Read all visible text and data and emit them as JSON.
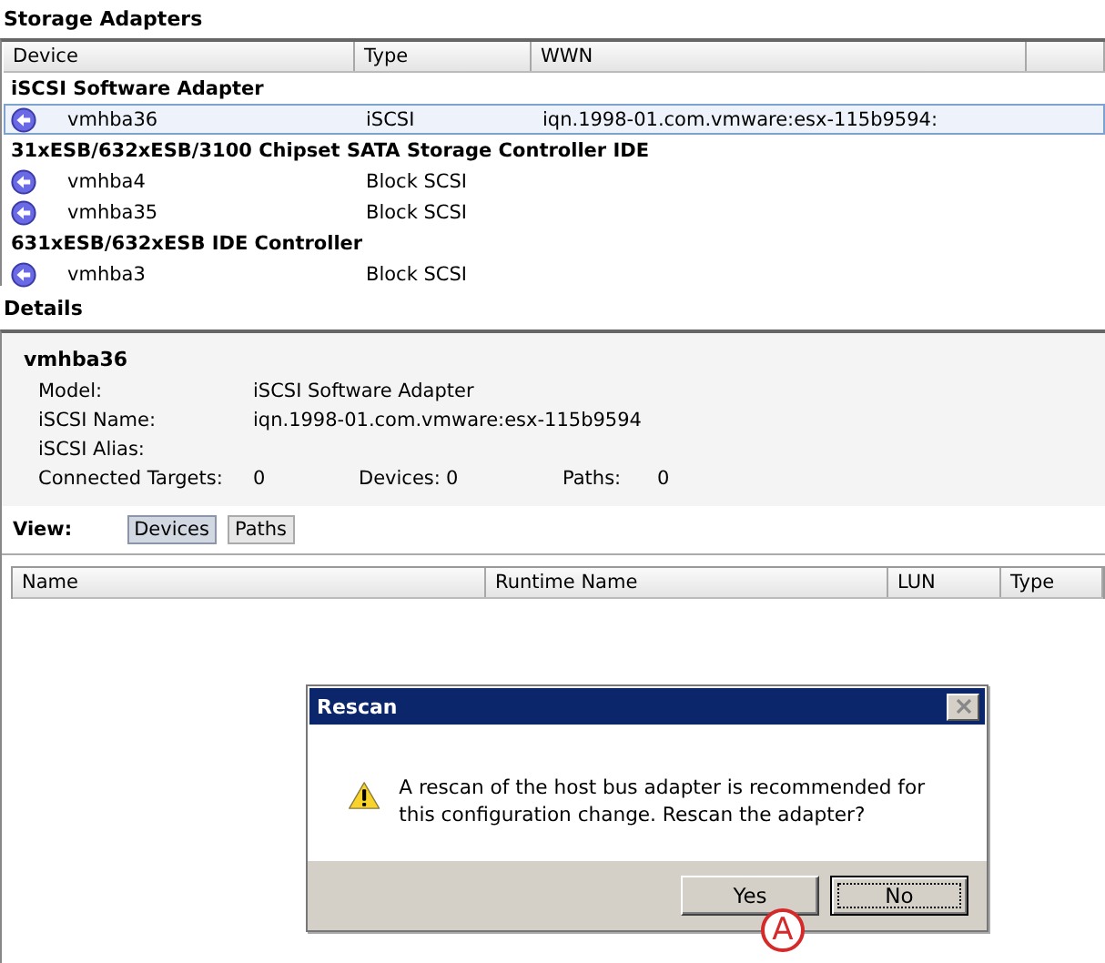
{
  "storage_adapters": {
    "title": "Storage Adapters",
    "columns": [
      "Device",
      "Type",
      "WWN"
    ],
    "groups": [
      {
        "name": "iSCSI Software Adapter",
        "children": [
          {
            "device": "vmhba36",
            "type": "iSCSI",
            "wwn": "iqn.1998-01.com.vmware:esx-115b9594:",
            "selected": true
          }
        ]
      },
      {
        "name": "31xESB/632xESB/3100 Chipset SATA Storage Controller IDE",
        "children": [
          {
            "device": "vmhba4",
            "type": "Block SCSI",
            "selected": false
          },
          {
            "device": "vmhba35",
            "type": "Block SCSI",
            "selected": false
          }
        ]
      },
      {
        "name": "631xESB/632xESB IDE Controller",
        "children": [
          {
            "device": "vmhba3",
            "type": "Block SCSI",
            "selected": false
          }
        ]
      }
    ]
  },
  "details": {
    "title": "Details",
    "name": "vmhba36",
    "fields": [
      {
        "label": "Model:",
        "value": "iSCSI Software Adapter"
      },
      {
        "label": "iSCSI Name:",
        "value": "iqn.1998-01.com.vmware:esx-115b9594"
      },
      {
        "label": "iSCSI Alias:"
      }
    ],
    "counts": [
      {
        "label": "Connected Targets:",
        "value": "0"
      },
      {
        "label": "Devices:",
        "value": "0"
      },
      {
        "label": "Paths:",
        "value": "0"
      }
    ],
    "view": {
      "label": "View:",
      "buttons": [
        {
          "label": "Devices",
          "selected": true
        },
        {
          "label": "Paths",
          "selected": false
        }
      ]
    },
    "columns": [
      "Name",
      "Runtime Name",
      "LUN",
      "Type"
    ]
  },
  "dialog": {
    "title": "Rescan",
    "message": "A rescan of the host bus adapter is recommended for this configuration change. Rescan the adapter?",
    "buttons": [
      {
        "label": "Yes",
        "focused": false
      },
      {
        "label": "No",
        "focused": true
      }
    ]
  },
  "callout": {
    "label": "A"
  }
}
